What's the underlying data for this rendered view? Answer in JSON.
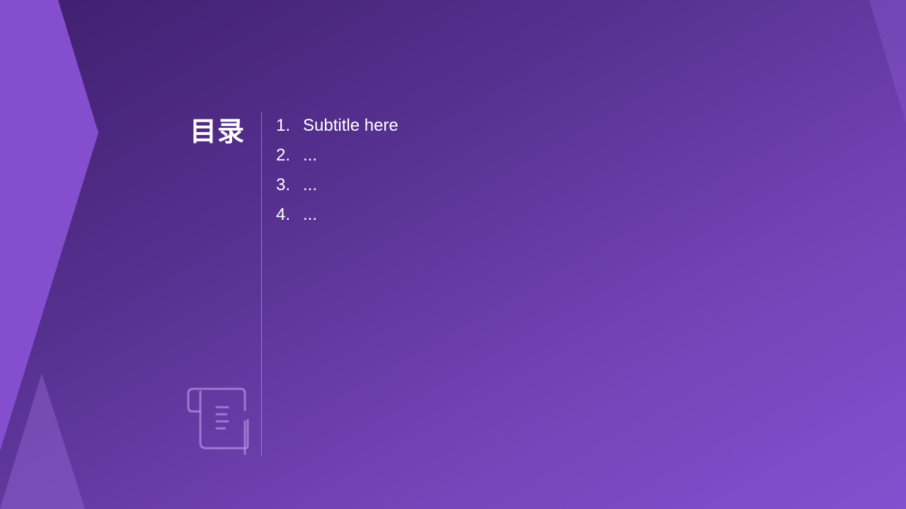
{
  "slide": {
    "title": "目录",
    "items": [
      {
        "number": "1.",
        "label": "Subtitle here"
      },
      {
        "number": "2.",
        "label": "..."
      },
      {
        "number": "3.",
        "label": "..."
      },
      {
        "number": "4.",
        "label": "..."
      }
    ],
    "icon": "scroll-document-icon"
  },
  "colors": {
    "background_dark": "#3f1f6e",
    "background_light": "#8350cf",
    "accent_shape": "#844ecf",
    "text": "#ffffff"
  }
}
